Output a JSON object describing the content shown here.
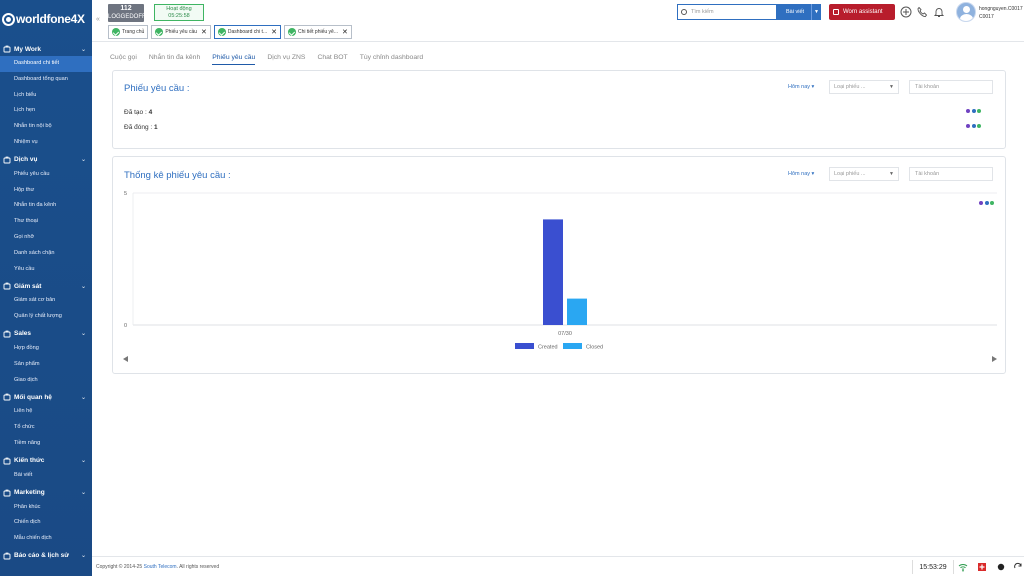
{
  "brand": {
    "logo_text": "worldfone4X"
  },
  "sidebar": {
    "sections": [
      {
        "title": "My Work",
        "items": [
          "Dashboard chi tiết",
          "Dashboard tổng quan",
          "Lịch biểu",
          "Lịch hẹn",
          "Nhắn tin nội bộ",
          "Nhiệm vụ"
        ]
      },
      {
        "title": "Dịch vụ",
        "items": [
          "Phiếu yêu cầu",
          "Hộp thư",
          "Nhắn tin đa kênh",
          "Thư thoại",
          "Gọi nhỡ",
          "Danh sách chặn",
          "Yêu cầu"
        ]
      },
      {
        "title": "Giám sát",
        "items": [
          "Giám sát cơ bản",
          "Quản lý chất lượng"
        ]
      },
      {
        "title": "Sales",
        "items": [
          "Hợp đồng",
          "Sản phẩm",
          "Giao dịch"
        ]
      },
      {
        "title": "Mối quan hệ",
        "items": [
          "Liên hệ",
          "Tổ chức",
          "Tiềm năng"
        ]
      },
      {
        "title": "Kiến thức",
        "items": [
          "Bài viết"
        ]
      },
      {
        "title": "Marketing",
        "items": [
          "Phân khúc",
          "Chiến dịch",
          "Mẫu chiến dịch"
        ]
      },
      {
        "title": "Báo cáo & lịch sử",
        "items": []
      }
    ],
    "active_item": "Dashboard chi tiết"
  },
  "header": {
    "extension": "112",
    "extension_status": "LOGGEDOFF",
    "activity_label": "Hoạt động",
    "activity_time": "05:25:58",
    "page_tabs": [
      {
        "label": "Trang chủ",
        "closable": false
      },
      {
        "label": "Phiếu yêu cầu",
        "closable": true
      },
      {
        "label": "Dashboard chi t...",
        "closable": true
      },
      {
        "label": "Chi tiết phiếu yê...",
        "closable": true
      }
    ],
    "search_placeholder": "Tìm kiếm",
    "search_type": "Bài viết",
    "assistant_label": "Worn assistant",
    "user_name": "hongnguyen.C0017",
    "user_code": "C0017"
  },
  "subtabs": [
    "Cuộc gọi",
    "Nhắn tin đa kênh",
    "Phiếu yêu cầu",
    "Dịch vụ ZNS",
    "Chat BOT",
    "Tùy chỉnh dashboard"
  ],
  "active_subtab": "Phiếu yêu cầu",
  "summary_card": {
    "title": "Phiếu yêu cầu :",
    "filter_period": "Hôm nay",
    "filter_type_placeholder": "Loại phiếu ...",
    "filter_account_placeholder": "Tài khoản",
    "stats": [
      {
        "label": "Đã tạo :",
        "value": "4"
      },
      {
        "label": "Đã đóng :",
        "value": "1"
      }
    ]
  },
  "chart_card": {
    "title": "Thống kê phiếu yêu cầu :",
    "filter_period": "Hôm nay",
    "filter_type_placeholder": "Loại phiếu ...",
    "filter_account_placeholder": "Tài khoản"
  },
  "chart_data": {
    "type": "bar",
    "categories": [
      "07/30"
    ],
    "series": [
      {
        "name": "Created",
        "values": [
          4
        ],
        "color": "#3a4fd0"
      },
      {
        "name": "Closed",
        "values": [
          1
        ],
        "color": "#2aa7f2"
      }
    ],
    "y_ticks": [
      "5",
      "0"
    ],
    "ylim": [
      0,
      5
    ],
    "legend_position": "bottom",
    "grid": true
  },
  "footer": {
    "copyright_prefix": "Copyright © 2014-25",
    "copyright_link": "South Telecom",
    "copyright_suffix": ". All rights reserved",
    "clock": "15:53:29"
  },
  "colors": {
    "sidebar_bg": "#1a4f8c",
    "accent": "#2f6fc0",
    "assistant": "#b81d2c",
    "dot1": "#6f42c1",
    "dot2": "#2f6fc0",
    "dot3": "#3fb563"
  }
}
